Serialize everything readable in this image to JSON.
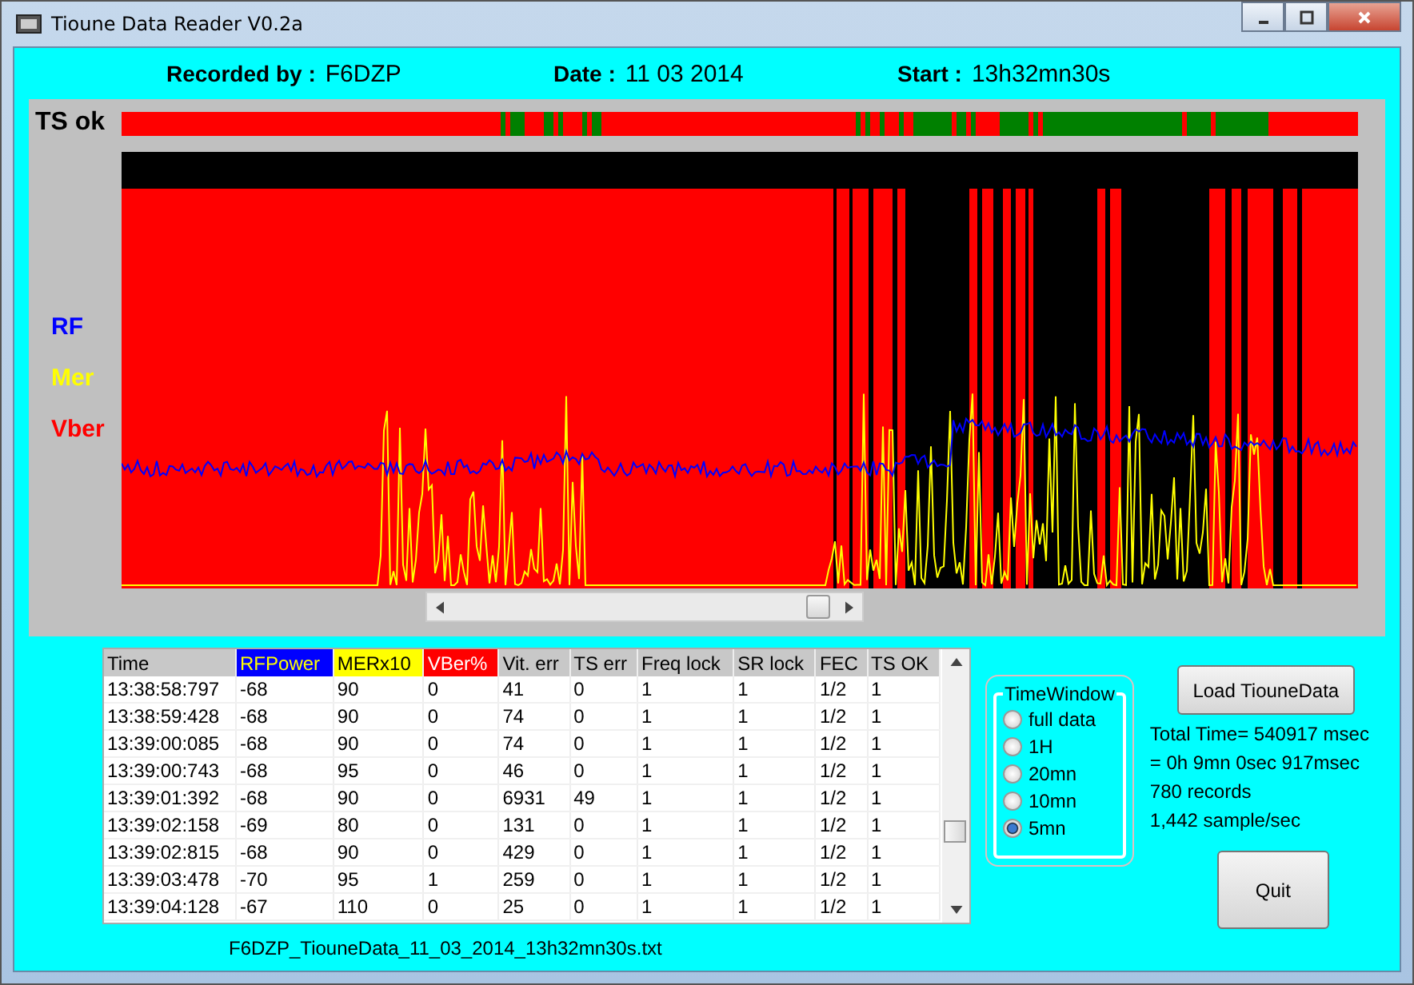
{
  "window": {
    "title": "Tioune Data Reader V0.2a"
  },
  "header": [
    {
      "label": "Recorded by :",
      "value": "F6DZP"
    },
    {
      "label": "Date :",
      "value": "11 03 2014"
    },
    {
      "label": "Start :",
      "value": "13h32mn30s"
    }
  ],
  "ts_label": "TS ok",
  "legend": [
    {
      "label": "RF",
      "color": "#0000ff"
    },
    {
      "label": "Mer",
      "color": "#ffff00"
    },
    {
      "label": "Vber",
      "color": "#ff0000"
    }
  ],
  "table": {
    "columns": [
      {
        "label": "Time"
      },
      {
        "label": "RFPower",
        "color": "#0000ff"
      },
      {
        "label": "MERx10",
        "color": "#ffff00"
      },
      {
        "label": "VBer%",
        "color": "#ff0000"
      },
      {
        "label": "Vit. err"
      },
      {
        "label": "TS err"
      },
      {
        "label": "Freq lock"
      },
      {
        "label": "SR lock"
      },
      {
        "label": "FEC"
      },
      {
        "label": "TS OK"
      }
    ],
    "rows": [
      [
        "13:38:58:797",
        "-68",
        "90",
        "0",
        "41",
        "0",
        "1",
        "1",
        "1/2",
        "1"
      ],
      [
        "13:38:59:428",
        "-68",
        "90",
        "0",
        "74",
        "0",
        "1",
        "1",
        "1/2",
        "1"
      ],
      [
        "13:39:00:085",
        "-68",
        "90",
        "0",
        "74",
        "0",
        "1",
        "1",
        "1/2",
        "1"
      ],
      [
        "13:39:00:743",
        "-68",
        "95",
        "0",
        "46",
        "0",
        "1",
        "1",
        "1/2",
        "1"
      ],
      [
        "13:39:01:392",
        "-68",
        "90",
        "0",
        "6931",
        "49",
        "1",
        "1",
        "1/2",
        "1"
      ],
      [
        "13:39:02:158",
        "-69",
        "80",
        "0",
        "131",
        "0",
        "1",
        "1",
        "1/2",
        "1"
      ],
      [
        "13:39:02:815",
        "-68",
        "90",
        "0",
        "429",
        "0",
        "1",
        "1",
        "1/2",
        "1"
      ],
      [
        "13:39:03:478",
        "-70",
        "95",
        "1",
        "259",
        "0",
        "1",
        "1",
        "1/2",
        "1"
      ],
      [
        "13:39:04:128",
        "-67",
        "110",
        "0",
        "25",
        "0",
        "1",
        "1",
        "1/2",
        "1"
      ]
    ]
  },
  "file_name": "F6DZP_TiouneData_11_03_2014_13h32mn30s.txt",
  "time_window": {
    "title": "TimeWindow",
    "options": [
      {
        "label": "full data",
        "selected": false
      },
      {
        "label": "1H",
        "selected": false
      },
      {
        "label": "20mn",
        "selected": false
      },
      {
        "label": "10mn",
        "selected": false
      },
      {
        "label": "5mn",
        "selected": true
      }
    ]
  },
  "load_button": "Load TiouneData",
  "stats": [
    "Total Time= 540917 msec",
    "= 0h 9mn 0sec 917msec",
    "780 records",
    "1,442 sample/sec"
  ],
  "quit_button": "Quit"
}
